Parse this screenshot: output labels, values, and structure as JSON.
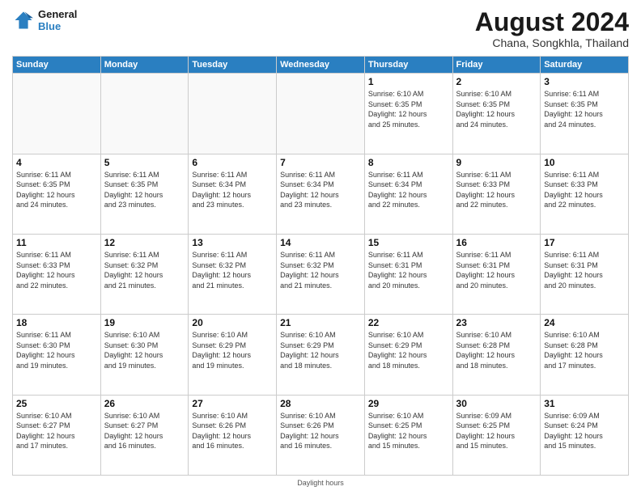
{
  "logo": {
    "line1": "General",
    "line2": "Blue"
  },
  "title": "August 2024",
  "subtitle": "Chana, Songkhla, Thailand",
  "days_of_week": [
    "Sunday",
    "Monday",
    "Tuesday",
    "Wednesday",
    "Thursday",
    "Friday",
    "Saturday"
  ],
  "footer": "Daylight hours",
  "weeks": [
    [
      {
        "day": "",
        "info": ""
      },
      {
        "day": "",
        "info": ""
      },
      {
        "day": "",
        "info": ""
      },
      {
        "day": "",
        "info": ""
      },
      {
        "day": "1",
        "info": "Sunrise: 6:10 AM\nSunset: 6:35 PM\nDaylight: 12 hours\nand 25 minutes."
      },
      {
        "day": "2",
        "info": "Sunrise: 6:10 AM\nSunset: 6:35 PM\nDaylight: 12 hours\nand 24 minutes."
      },
      {
        "day": "3",
        "info": "Sunrise: 6:11 AM\nSunset: 6:35 PM\nDaylight: 12 hours\nand 24 minutes."
      }
    ],
    [
      {
        "day": "4",
        "info": "Sunrise: 6:11 AM\nSunset: 6:35 PM\nDaylight: 12 hours\nand 24 minutes."
      },
      {
        "day": "5",
        "info": "Sunrise: 6:11 AM\nSunset: 6:35 PM\nDaylight: 12 hours\nand 23 minutes."
      },
      {
        "day": "6",
        "info": "Sunrise: 6:11 AM\nSunset: 6:34 PM\nDaylight: 12 hours\nand 23 minutes."
      },
      {
        "day": "7",
        "info": "Sunrise: 6:11 AM\nSunset: 6:34 PM\nDaylight: 12 hours\nand 23 minutes."
      },
      {
        "day": "8",
        "info": "Sunrise: 6:11 AM\nSunset: 6:34 PM\nDaylight: 12 hours\nand 22 minutes."
      },
      {
        "day": "9",
        "info": "Sunrise: 6:11 AM\nSunset: 6:33 PM\nDaylight: 12 hours\nand 22 minutes."
      },
      {
        "day": "10",
        "info": "Sunrise: 6:11 AM\nSunset: 6:33 PM\nDaylight: 12 hours\nand 22 minutes."
      }
    ],
    [
      {
        "day": "11",
        "info": "Sunrise: 6:11 AM\nSunset: 6:33 PM\nDaylight: 12 hours\nand 22 minutes."
      },
      {
        "day": "12",
        "info": "Sunrise: 6:11 AM\nSunset: 6:32 PM\nDaylight: 12 hours\nand 21 minutes."
      },
      {
        "day": "13",
        "info": "Sunrise: 6:11 AM\nSunset: 6:32 PM\nDaylight: 12 hours\nand 21 minutes."
      },
      {
        "day": "14",
        "info": "Sunrise: 6:11 AM\nSunset: 6:32 PM\nDaylight: 12 hours\nand 21 minutes."
      },
      {
        "day": "15",
        "info": "Sunrise: 6:11 AM\nSunset: 6:31 PM\nDaylight: 12 hours\nand 20 minutes."
      },
      {
        "day": "16",
        "info": "Sunrise: 6:11 AM\nSunset: 6:31 PM\nDaylight: 12 hours\nand 20 minutes."
      },
      {
        "day": "17",
        "info": "Sunrise: 6:11 AM\nSunset: 6:31 PM\nDaylight: 12 hours\nand 20 minutes."
      }
    ],
    [
      {
        "day": "18",
        "info": "Sunrise: 6:11 AM\nSunset: 6:30 PM\nDaylight: 12 hours\nand 19 minutes."
      },
      {
        "day": "19",
        "info": "Sunrise: 6:10 AM\nSunset: 6:30 PM\nDaylight: 12 hours\nand 19 minutes."
      },
      {
        "day": "20",
        "info": "Sunrise: 6:10 AM\nSunset: 6:29 PM\nDaylight: 12 hours\nand 19 minutes."
      },
      {
        "day": "21",
        "info": "Sunrise: 6:10 AM\nSunset: 6:29 PM\nDaylight: 12 hours\nand 18 minutes."
      },
      {
        "day": "22",
        "info": "Sunrise: 6:10 AM\nSunset: 6:29 PM\nDaylight: 12 hours\nand 18 minutes."
      },
      {
        "day": "23",
        "info": "Sunrise: 6:10 AM\nSunset: 6:28 PM\nDaylight: 12 hours\nand 18 minutes."
      },
      {
        "day": "24",
        "info": "Sunrise: 6:10 AM\nSunset: 6:28 PM\nDaylight: 12 hours\nand 17 minutes."
      }
    ],
    [
      {
        "day": "25",
        "info": "Sunrise: 6:10 AM\nSunset: 6:27 PM\nDaylight: 12 hours\nand 17 minutes."
      },
      {
        "day": "26",
        "info": "Sunrise: 6:10 AM\nSunset: 6:27 PM\nDaylight: 12 hours\nand 16 minutes."
      },
      {
        "day": "27",
        "info": "Sunrise: 6:10 AM\nSunset: 6:26 PM\nDaylight: 12 hours\nand 16 minutes."
      },
      {
        "day": "28",
        "info": "Sunrise: 6:10 AM\nSunset: 6:26 PM\nDaylight: 12 hours\nand 16 minutes."
      },
      {
        "day": "29",
        "info": "Sunrise: 6:10 AM\nSunset: 6:25 PM\nDaylight: 12 hours\nand 15 minutes."
      },
      {
        "day": "30",
        "info": "Sunrise: 6:09 AM\nSunset: 6:25 PM\nDaylight: 12 hours\nand 15 minutes."
      },
      {
        "day": "31",
        "info": "Sunrise: 6:09 AM\nSunset: 6:24 PM\nDaylight: 12 hours\nand 15 minutes."
      }
    ]
  ]
}
